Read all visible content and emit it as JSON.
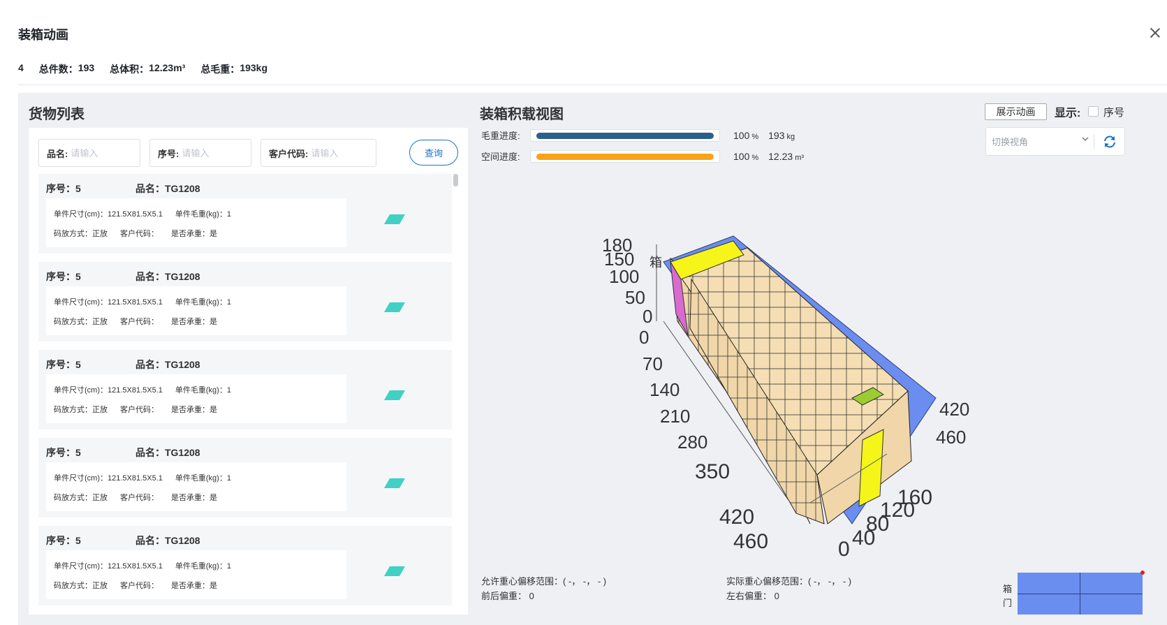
{
  "dialog": {
    "title": "装箱动画"
  },
  "summary": {
    "index": "4",
    "total_count_label": "总件数：",
    "total_count": "193",
    "total_volume_label": "总体积：",
    "total_volume": "12.23m³",
    "total_weight_label": "总毛重：",
    "total_weight": "193kg"
  },
  "left": {
    "title": "货物列表",
    "filters": [
      {
        "label": "品名:",
        "placeholder": "请输入"
      },
      {
        "label": "序号:",
        "placeholder": "请输入"
      },
      {
        "label": "客户代码:",
        "placeholder": "请输入"
      }
    ],
    "query_label": "查询",
    "items": [
      {
        "seq": "序号：5",
        "name": "品名：TG1208",
        "size": "单件尺寸(cm)：121.5X81.5X5.1",
        "weight": "单件毛重(kg)：1",
        "stacking": "码放方式：正放",
        "customer": "客户代码：",
        "load_bearing": "是否承重：是"
      },
      {
        "seq": "序号：5",
        "name": "品名：TG1208",
        "size": "单件尺寸(cm)：121.5X81.5X5.1",
        "weight": "单件毛重(kg)：1",
        "stacking": "码放方式：正放",
        "customer": "客户代码：",
        "load_bearing": "是否承重：是"
      },
      {
        "seq": "序号：5",
        "name": "品名：TG1208",
        "size": "单件尺寸(cm)：121.5X81.5X5.1",
        "weight": "单件毛重(kg)：1",
        "stacking": "码放方式：正放",
        "customer": "客户代码：",
        "load_bearing": "是否承重：是"
      },
      {
        "seq": "序号：5",
        "name": "品名：TG1208",
        "size": "单件尺寸(cm)：121.5X81.5X5.1",
        "weight": "单件毛重(kg)：1",
        "stacking": "码放方式：正放",
        "customer": "客户代码：",
        "load_bearing": "是否承重：是"
      },
      {
        "seq": "序号：5",
        "name": "品名：TG1208",
        "size": "单件尺寸(cm)：121.5X81.5X5.1",
        "weight": "单件毛重(kg)：1",
        "stacking": "码放方式：正放",
        "customer": "客户代码：",
        "load_bearing": "是否承重：是"
      }
    ],
    "item_icon": "cargo-box-icon",
    "item_icon_color": "#3fd1c4"
  },
  "right": {
    "title": "装箱积载视图",
    "weight_progress": {
      "label": "毛重进度:",
      "percent": 100,
      "percent_text": "100",
      "percent_unit": "%",
      "value": "193",
      "unit": "kg",
      "color": "#2a5f8f"
    },
    "space_progress": {
      "label": "空间进度:",
      "percent": 100,
      "percent_text": "100",
      "percent_unit": "%",
      "value": "12.23",
      "unit": "m³",
      "color": "#f7a41a"
    },
    "show_animation_label": "展示动画",
    "display_label": "显示:",
    "seq_checkbox_label": "序号",
    "view_select_placeholder": "切换视角",
    "axis_height_ticks": [
      "180",
      "150",
      "100",
      "50",
      "0"
    ],
    "axis_height_label": "箱",
    "axis_length_ticks": [
      "0",
      "70",
      "140",
      "210",
      "280",
      "350",
      "420",
      "460"
    ],
    "axis_width_ticks": [
      "160",
      "120",
      "80",
      "40",
      "0"
    ],
    "axis_right_ticks": [
      "420",
      "460"
    ],
    "cargo_color": "#f5deb3",
    "container_color": "#6b8df0"
  },
  "footer": {
    "allowed_range": "允许重心偏移范围：( -， -， - )",
    "front_back": "前后偏重：  0",
    "actual_range": "实际重心偏移范围：( -， -， - )",
    "left_right": "左右偏重：  0",
    "door_1": "箱",
    "door_2": "门"
  }
}
